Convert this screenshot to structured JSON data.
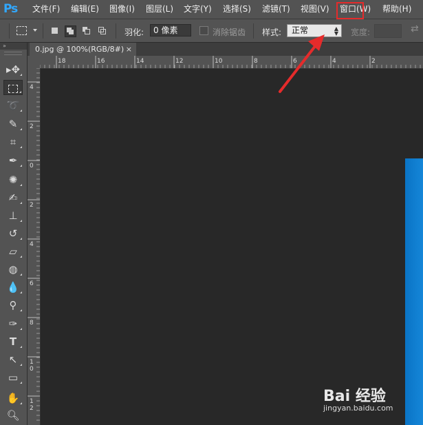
{
  "app": {
    "logo": "Ps"
  },
  "menu": [
    {
      "id": "file",
      "label": "文件(F)"
    },
    {
      "id": "edit",
      "label": "编辑(E)"
    },
    {
      "id": "image",
      "label": "图像(I)"
    },
    {
      "id": "layer",
      "label": "图层(L)"
    },
    {
      "id": "type",
      "label": "文字(Y)"
    },
    {
      "id": "select",
      "label": "选择(S)"
    },
    {
      "id": "filter",
      "label": "滤镜(T)"
    },
    {
      "id": "view",
      "label": "视图(V)"
    },
    {
      "id": "window",
      "label": "窗口(W)"
    },
    {
      "id": "help",
      "label": "帮助(H)"
    }
  ],
  "options": {
    "feather_label": "羽化:",
    "feather_value": "0 像素",
    "antialias_label": "消除锯齿",
    "style_label": "样式:",
    "style_value": "正常",
    "width_label": "宽度:"
  },
  "document": {
    "tab_title": "0.jpg @ 100%(RGB/8#)",
    "close": "×"
  },
  "toolbox": {
    "header": "»"
  },
  "rulers": {
    "horizontal": [
      "18",
      "16",
      "14",
      "12",
      "10",
      "8",
      "6",
      "4",
      "2"
    ],
    "vertical": [
      "4",
      "2",
      "0",
      "2",
      "4",
      "6",
      "8",
      "1\n0",
      "1\n2"
    ]
  },
  "annotation": {
    "color": "#e52b2b"
  },
  "watermark": {
    "brand": "Bai 经验",
    "url": "jingyan.baidu.com"
  }
}
